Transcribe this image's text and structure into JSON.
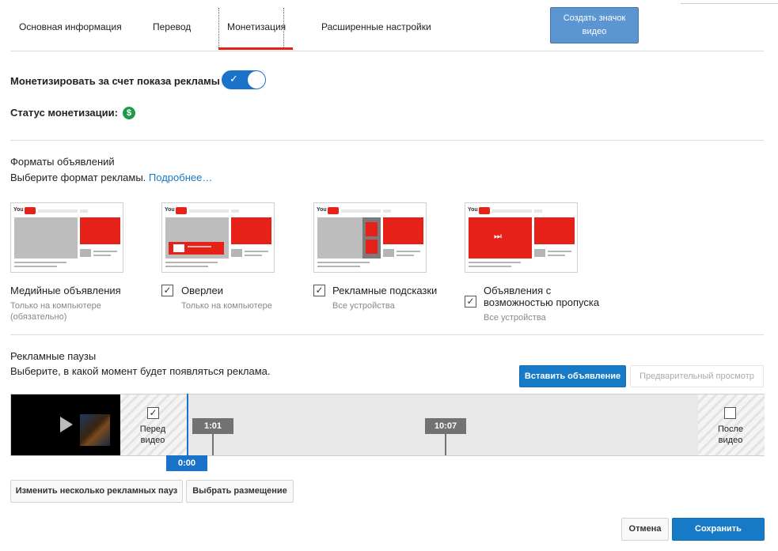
{
  "tabs": [
    {
      "label": "Основная информация"
    },
    {
      "label": "Перевод"
    },
    {
      "label": "Монетизация"
    },
    {
      "label": "Расширенные настройки"
    }
  ],
  "create_thumb_button": {
    "line1": "Создать значок",
    "line2": "видео"
  },
  "monetize": {
    "label": "Монетизировать за счет показа рекламы",
    "toggle_on": true,
    "status_label": "Статус монетизации:",
    "status_icon": "$"
  },
  "formats": {
    "title": "Форматы объявлений",
    "subtitle": "Выберите формат рекламы.",
    "more_link": "Подробнее…",
    "items": [
      {
        "label": "Медийные объявления",
        "note1": "Только на компьютере",
        "note2": "(обязательно)",
        "checked": null
      },
      {
        "label": "Оверлеи",
        "note1": "Только на компьютере",
        "checked": true
      },
      {
        "label": "Рекламные подсказки",
        "note1": "Все устройства",
        "checked": true
      },
      {
        "label1": "Объявления с",
        "label2": "возможностью пропуска",
        "note1": "Все устройства",
        "checked": true
      }
    ],
    "thumb_logo": "You"
  },
  "breaks": {
    "title": "Рекламные паузы",
    "subtitle": "Выберите, в какой момент будет появляться реклама.",
    "insert_button": "Вставить объявление",
    "preview_button": "Предварительный просмотр",
    "before": {
      "line1": "Перед",
      "line2": "видео",
      "checked": true
    },
    "after": {
      "line1": "После",
      "line2": "видео",
      "checked": false
    },
    "markers": [
      "1:01",
      "10:07"
    ],
    "playhead": "0:00"
  },
  "actions": {
    "edit_multiple": "Изменить несколько рекламных пауз",
    "choose_placement": "Выбрать размещение",
    "cancel": "Отмена",
    "save": "Сохранить"
  },
  "colors": {
    "accent": "#167ac6",
    "tab_underline": "#e62117",
    "money": "#1e9b4a"
  }
}
